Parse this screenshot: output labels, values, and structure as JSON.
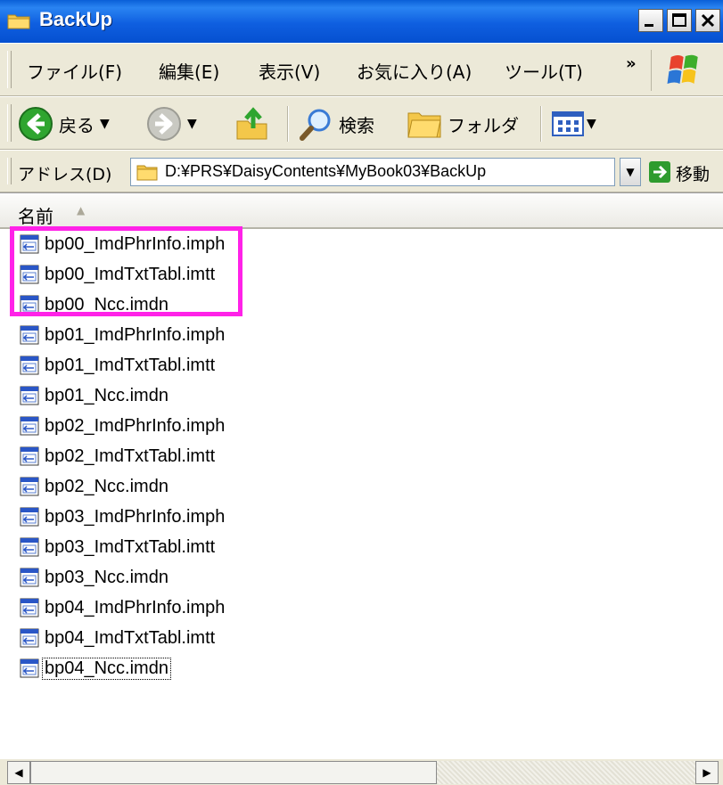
{
  "window": {
    "title": "BackUp"
  },
  "menubar": {
    "items": [
      "ファイル(F)",
      "編集(E)",
      "表示(V)",
      "お気に入り(A)",
      "ツール(T)"
    ],
    "overflow": "»"
  },
  "toolbar": {
    "back": "戻る",
    "search": "検索",
    "folders": "フォルダ"
  },
  "address": {
    "label": "アドレス(D)",
    "path": "D:¥PRS¥DaisyContents¥MyBook03¥BackUp",
    "go": "移動"
  },
  "list": {
    "column_header": "名前",
    "files": [
      "bp00_ImdPhrInfo.imph",
      "bp00_ImdTxtTabl.imtt",
      "bp00_Ncc.imdn",
      "bp01_ImdPhrInfo.imph",
      "bp01_ImdTxtTabl.imtt",
      "bp01_Ncc.imdn",
      "bp02_ImdPhrInfo.imph",
      "bp02_ImdTxtTabl.imtt",
      "bp02_Ncc.imdn",
      "bp03_ImdPhrInfo.imph",
      "bp03_ImdTxtTabl.imtt",
      "bp03_Ncc.imdn",
      "bp04_ImdPhrInfo.imph",
      "bp04_ImdTxtTabl.imtt",
      "bp04_Ncc.imdn"
    ]
  },
  "colors": {
    "titlebar": "#0a5fd8",
    "highlight": "#ff22e8",
    "chrome": "#ece9d8"
  },
  "icons": [
    "folder-icon",
    "back-arrow-icon",
    "forward-arrow-icon",
    "up-folder-icon",
    "search-icon",
    "folders-icon",
    "views-icon",
    "go-arrow-icon",
    "file-icon",
    "windows-logo-icon"
  ]
}
